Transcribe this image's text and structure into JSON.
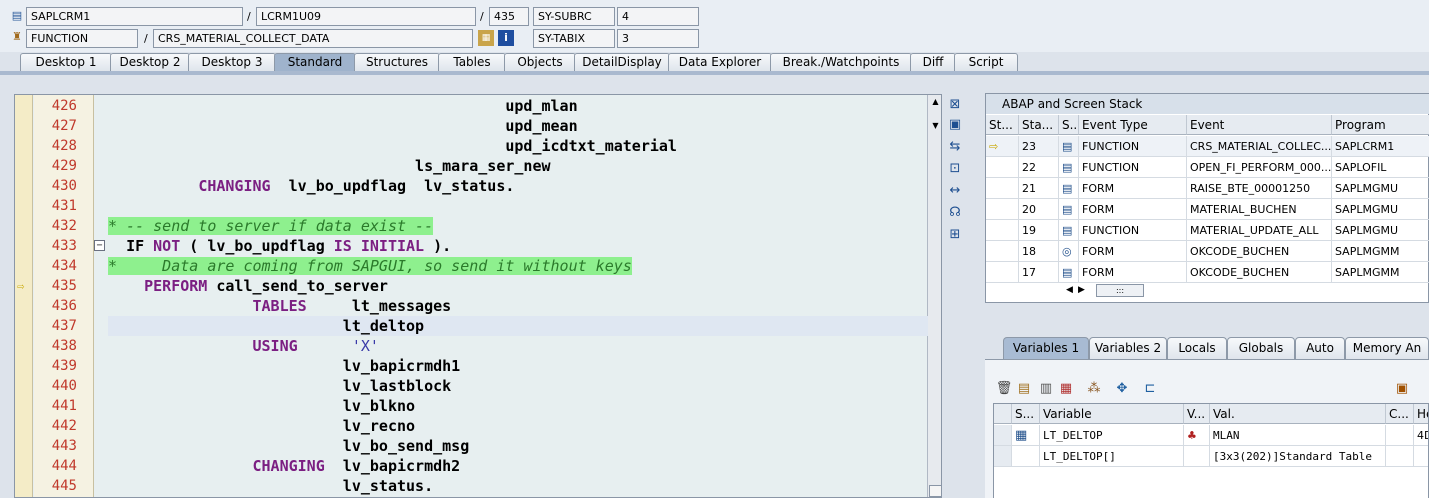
{
  "header": {
    "program": "SAPLCRM1",
    "include": "LCRM1U09",
    "line": "435",
    "subrc_label": "SY-SUBRC",
    "subrc_value": "4",
    "type": "FUNCTION",
    "name": "CRS_MATERIAL_COLLECT_DATA",
    "tabix_label": "SY-TABIX",
    "tabix_value": "3",
    "slash": "/"
  },
  "tabs": [
    "Desktop 1",
    "Desktop 2",
    "Desktop 3",
    "Standard",
    "Structures",
    "Tables",
    "Objects",
    "DetailDisplay",
    "Data Explorer",
    "Break./Watchpoints",
    "Diff",
    "Script"
  ],
  "active_tab": "Standard",
  "code_lines": [
    {
      "num": "426",
      "text": "                                            upd_mlan"
    },
    {
      "num": "427",
      "text": "                                            upd_mean"
    },
    {
      "num": "428",
      "text": "                                            upd_icdtxt_material"
    },
    {
      "num": "429",
      "text": "                                  ls_mara_ser_new"
    },
    {
      "num": "430",
      "pre": "          ",
      "kw": "CHANGING",
      "post": "  lv_bo_updflag  lv_status."
    },
    {
      "num": "431",
      "text": ""
    },
    {
      "num": "432",
      "comment": "* -- send to server if data exist --"
    },
    {
      "num": "433",
      "if_line": true
    },
    {
      "num": "434",
      "comment": "*     Data are coming from SAPGUI, so send it without keys"
    },
    {
      "num": "435",
      "pre": "    ",
      "kw": "PERFORM",
      "post": " call_send_to_server"
    },
    {
      "num": "436",
      "pre": "                ",
      "kw": "TABLES",
      "post": "     lt_messages"
    },
    {
      "num": "437",
      "text": "                          lt_deltop"
    },
    {
      "num": "438",
      "pre": "                ",
      "kw": "USING",
      "post": "      ",
      "str": "'X'"
    },
    {
      "num": "439",
      "text": "                          lv_bapicrmdh1"
    },
    {
      "num": "440",
      "text": "                          lv_lastblock"
    },
    {
      "num": "441",
      "text": "                          lv_blkno"
    },
    {
      "num": "442",
      "text": "                          lv_recno"
    },
    {
      "num": "443",
      "text": "                          lv_bo_send_msg"
    },
    {
      "num": "444",
      "pre": "                ",
      "kw": "CHANGING",
      "post": "  lv_bapicrmdh2"
    },
    {
      "num": "445",
      "text": "                          lv_status."
    }
  ],
  "if_line": {
    "kw1": "IF",
    "kw2": "NOT",
    "mid": " ( lv_bo_updflag ",
    "kw3": "IS",
    "kw4": "INITIAL",
    "end": " )."
  },
  "stack": {
    "title": "ABAP and Screen Stack",
    "columns": [
      "St...",
      "Sta...",
      "S...",
      "Event Type",
      "Event",
      "Program"
    ],
    "rows": [
      {
        "level": "23",
        "type": "FUNCTION",
        "event": "CRS_MATERIAL_COLLEC...",
        "program": "SAPLCRM1",
        "current": true
      },
      {
        "level": "22",
        "type": "FUNCTION",
        "event": "OPEN_FI_PERFORM_000...",
        "program": "SAPLOFIL"
      },
      {
        "level": "21",
        "type": "FORM",
        "event": "RAISE_BTE_00001250",
        "program": "SAPLMGMU"
      },
      {
        "level": "20",
        "type": "FORM",
        "event": "MATERIAL_BUCHEN",
        "program": "SAPLMGMU"
      },
      {
        "level": "19",
        "type": "FUNCTION",
        "event": "MATERIAL_UPDATE_ALL",
        "program": "SAPLMGMU"
      },
      {
        "level": "18",
        "type": "FORM",
        "event": "OKCODE_BUCHEN",
        "program": "SAPLMGMM"
      },
      {
        "level": "17",
        "type": "FORM",
        "event": "OKCODE_BUCHEN",
        "program": "SAPLMGMM"
      }
    ],
    "scroll_grip": ":::"
  },
  "var_tabs": [
    "Variables 1",
    "Variables 2",
    "Locals",
    "Globals",
    "Auto",
    "Memory An"
  ],
  "active_var_tab": "Variables 1",
  "vars": {
    "columns": [
      "S...",
      "Variable",
      "V...",
      "Val.",
      "C...",
      "He"
    ],
    "rows": [
      {
        "variable": "LT_DELTOP",
        "value": "MLAN",
        "hex": "4D"
      },
      {
        "variable": "LT_DELTOP[]",
        "value": "[3x3(202)]Standard Table",
        "hex": ""
      }
    ]
  },
  "icons": {
    "program": "program-icon",
    "function": "function-icon",
    "info": "info-icon",
    "stack_marker": "arrow-right-icon"
  }
}
